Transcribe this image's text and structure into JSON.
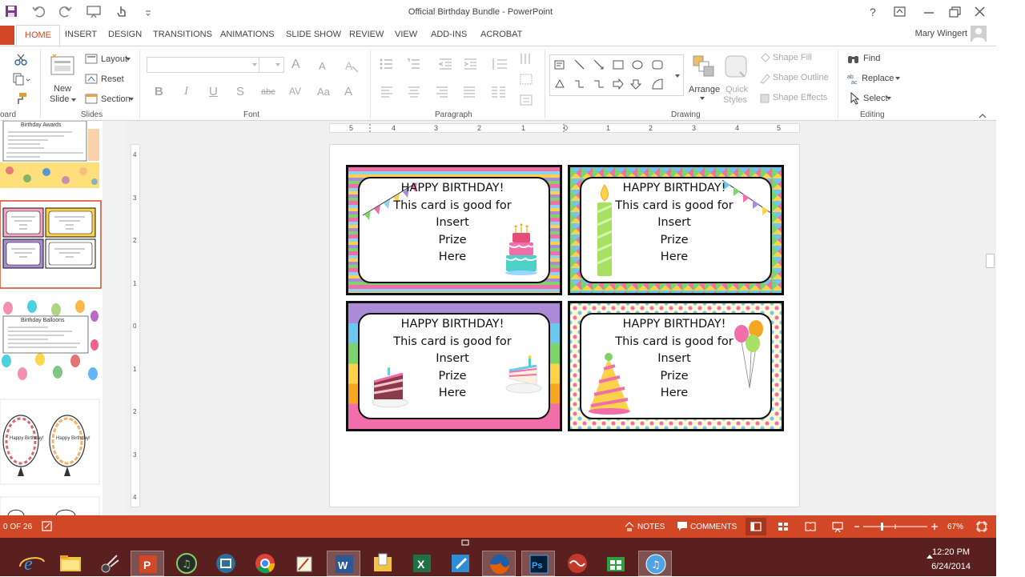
{
  "window": {
    "title": "Official Birthday Bundle - PowerPoint",
    "user": "Mary Wingert"
  },
  "tabs": [
    "HOME",
    "INSERT",
    "DESIGN",
    "TRANSITIONS",
    "ANIMATIONS",
    "SLIDE SHOW",
    "REVIEW",
    "VIEW",
    "ADD-INS",
    "ACROBAT"
  ],
  "ribbon": {
    "clipboard_label": "oard",
    "slides": {
      "new_slide": "New",
      "new_slide2": "Slide",
      "layout": "Layout",
      "reset": "Reset",
      "section": "Section",
      "label": "Slides"
    },
    "font": {
      "label": "Font",
      "bold": "B",
      "italic": "I",
      "underline": "U",
      "shadow": "S",
      "strike": "abc",
      "spacing": "AV",
      "case": "Aa",
      "color": "A",
      "grow": "A",
      "shrink": "A"
    },
    "paragraph_label": "Paragraph",
    "drawing": {
      "label": "Drawing",
      "arrange": "Arrange",
      "quick_styles1": "Quick",
      "quick_styles2": "Styles",
      "shape_fill": "Shape Fill",
      "shape_outline": "Shape Outline",
      "shape_effects": "Shape Effects"
    },
    "editing": {
      "label": "Editing",
      "find": "Find",
      "replace": "Replace",
      "select": "Select"
    }
  },
  "ruler": {
    "h_ticks": [
      "5",
      "4",
      "3",
      "2",
      "1",
      "0",
      "1",
      "2",
      "3",
      "4",
      "5"
    ],
    "v_ticks": [
      "4",
      "3",
      "2",
      "1",
      "0",
      "1",
      "2",
      "3",
      "4"
    ]
  },
  "thumbnails": {
    "slide1_title": "Birthday Awards",
    "slide3_title": "Birthday Balloons",
    "balloon_text": "Happy Birthday!"
  },
  "cards": [
    {
      "line1": "HAPPY BIRTHDAY!",
      "line2": "This card is good for",
      "line3": "Insert",
      "line4": "Prize",
      "line5": "Here"
    },
    {
      "line1": "HAPPY BIRTHDAY!",
      "line2": "This card is good for",
      "line3": "Insert",
      "line4": "Prize",
      "line5": "Here"
    },
    {
      "line1": "HAPPY BIRTHDAY!",
      "line2": "This card is good for",
      "line3": "Insert",
      "line4": "Prize",
      "line5": "Here"
    },
    {
      "line1": "HAPPY BIRTHDAY!",
      "line2": "This card is good for",
      "line3": "Insert",
      "line4": "Prize",
      "line5": "Here"
    }
  ],
  "status": {
    "slide_count": "0 OF 26",
    "notes": "NOTES",
    "comments": "COMMENTS",
    "zoom": "67%"
  },
  "taskbar": {
    "time": "12:20 PM",
    "date": "6/24/2014"
  },
  "colors": {
    "accent": "#d24726",
    "taskbar": "#5a1f1f"
  }
}
